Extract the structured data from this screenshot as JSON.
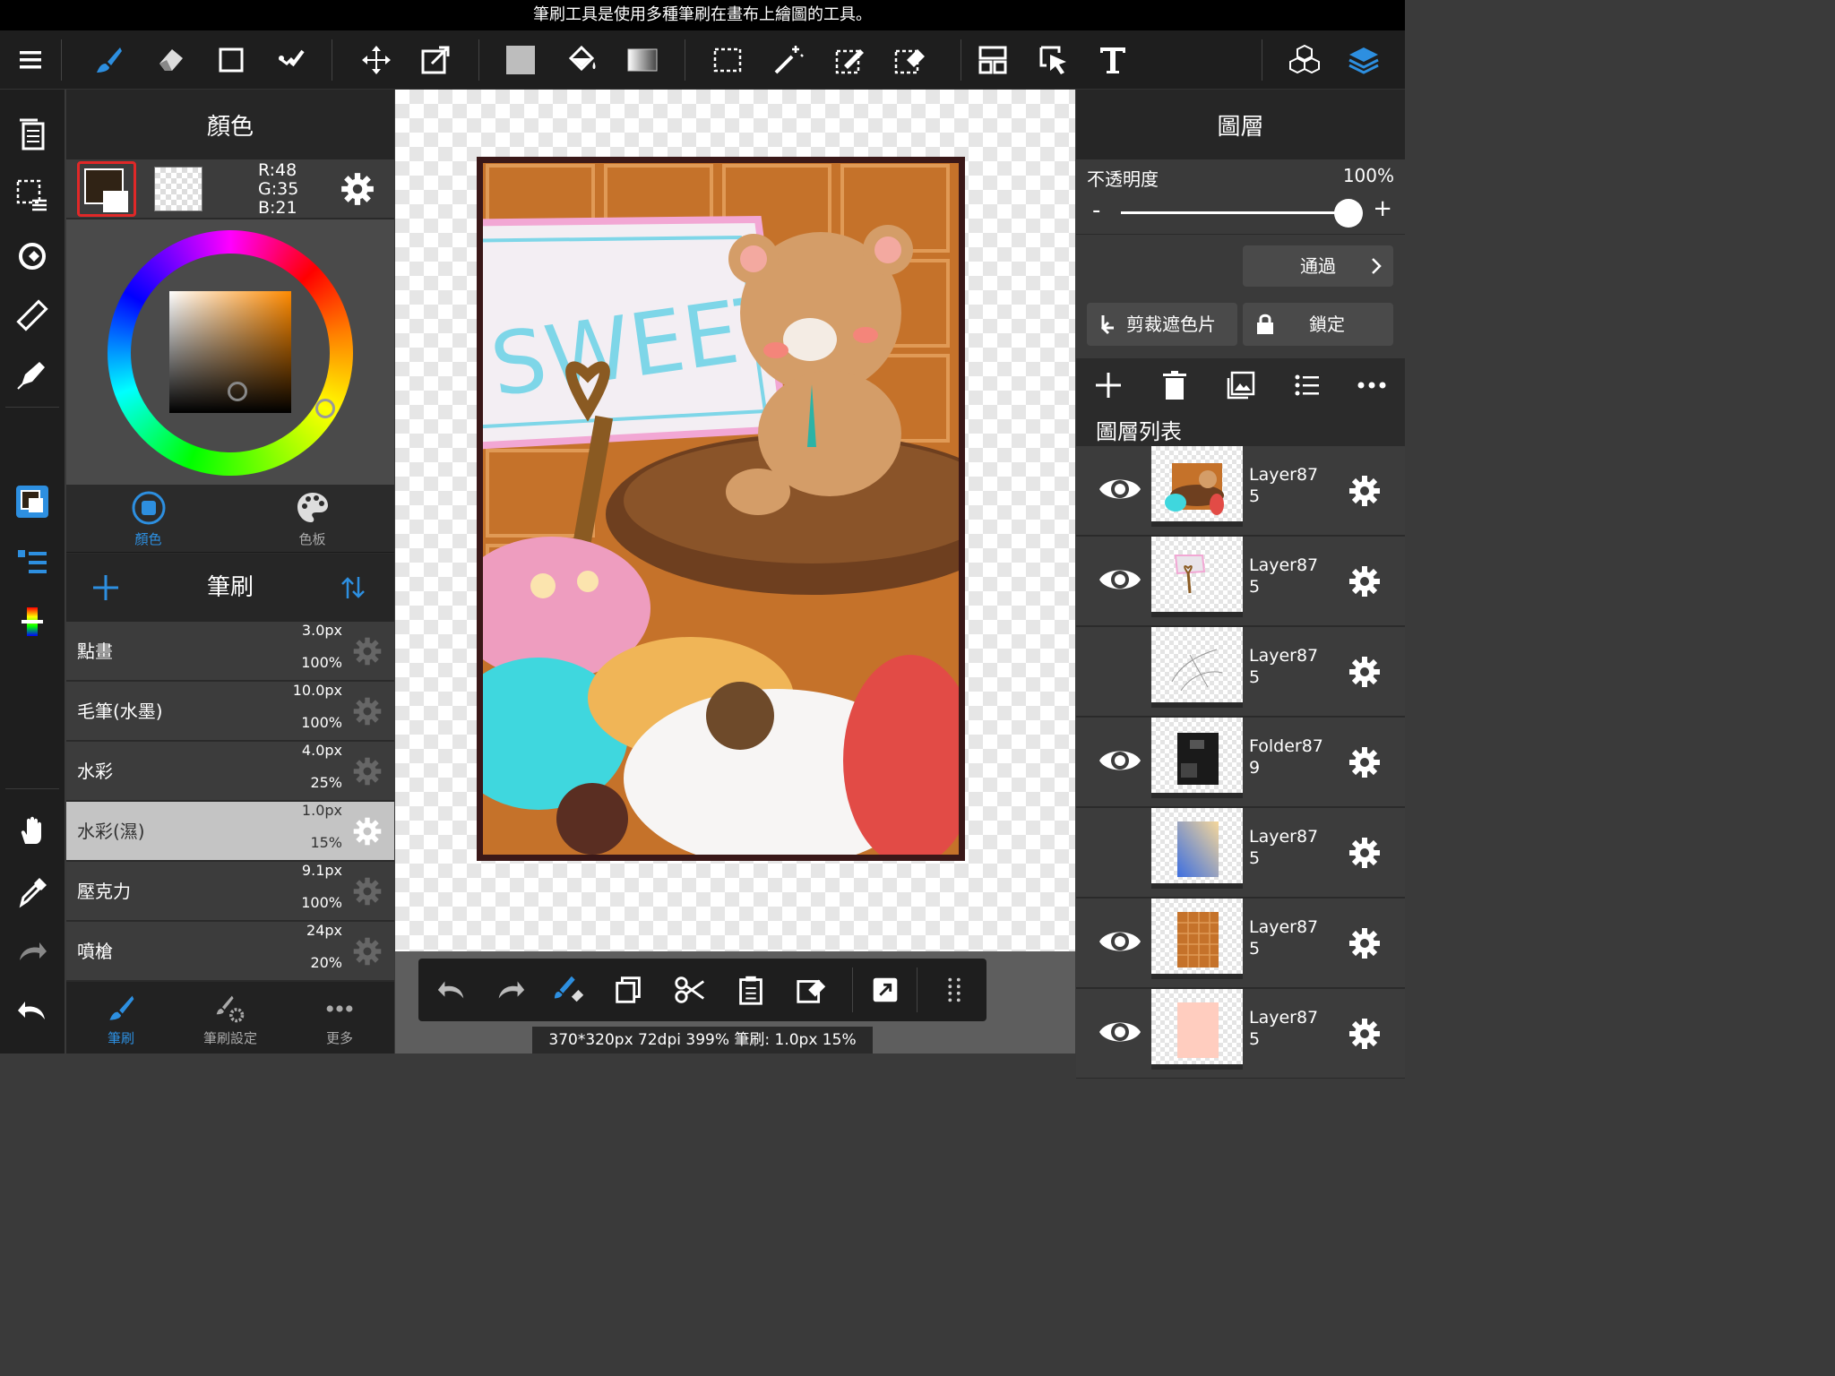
{
  "tooltip": "筆刷工具是使用多種筆刷在畫布上繪圖的工具。",
  "toolbar": {
    "tools": [
      "menu-icon",
      "brush-icon",
      "eraser-icon",
      "shape-icon",
      "correction-icon",
      "move-icon",
      "transform-icon",
      "fill-color-icon",
      "bucket-icon",
      "gradient-icon",
      "select-icon",
      "magic-wand-icon",
      "select-pen-icon",
      "select-eraser-icon",
      "layout-icon",
      "operation-icon",
      "text-icon",
      "3d-cubes-icon",
      "layers-icon"
    ]
  },
  "color_panel": {
    "title": "顏色",
    "r": "R:48",
    "g": "G:35",
    "b": "B:21",
    "fg_color": "#302315",
    "tab_color": "顏色",
    "tab_palette": "色板"
  },
  "brush_panel": {
    "title": "筆刷",
    "brushes": [
      {
        "name": "點畫",
        "size": "3.0px",
        "opacity": "100%"
      },
      {
        "name": "毛筆(水墨)",
        "size": "10.0px",
        "opacity": "100%"
      },
      {
        "name": "水彩",
        "size": "4.0px",
        "opacity": "25%"
      },
      {
        "name": "水彩(濕)",
        "size": "1.0px",
        "opacity": "15%"
      },
      {
        "name": "壓克力",
        "size": "9.1px",
        "opacity": "100%"
      },
      {
        "name": "噴槍",
        "size": "24px",
        "opacity": "20%"
      }
    ],
    "tab_brush": "筆刷",
    "tab_settings": "筆刷設定",
    "tab_more": "更多"
  },
  "canvas": {
    "art_text": "SWEET"
  },
  "status": "370*320px 72dpi 399% 筆刷: 1.0px 15%",
  "layers_panel": {
    "title": "圖層",
    "opacity_label": "不透明度",
    "opacity_value": "100%",
    "opacity_fraction": 1.0,
    "minus": "-",
    "plus": "+",
    "blend": "通過",
    "clip": "剪裁遮色片",
    "lock": "鎖定",
    "list_title": "圖層列表",
    "layers": [
      {
        "name": "Layer87",
        "sub": "5",
        "visible": true
      },
      {
        "name": "Layer87",
        "sub": "5",
        "visible": true
      },
      {
        "name": "Layer87",
        "sub": "5",
        "visible": false
      },
      {
        "name": "Folder87",
        "sub": "9",
        "visible": true
      },
      {
        "name": "Layer87",
        "sub": "5",
        "visible": false
      },
      {
        "name": "Layer87",
        "sub": "5",
        "visible": true
      },
      {
        "name": "Layer87",
        "sub": "5",
        "visible": true
      }
    ]
  },
  "colors": {
    "accent": "#2d8fe0",
    "selected_red": "#e02828"
  }
}
